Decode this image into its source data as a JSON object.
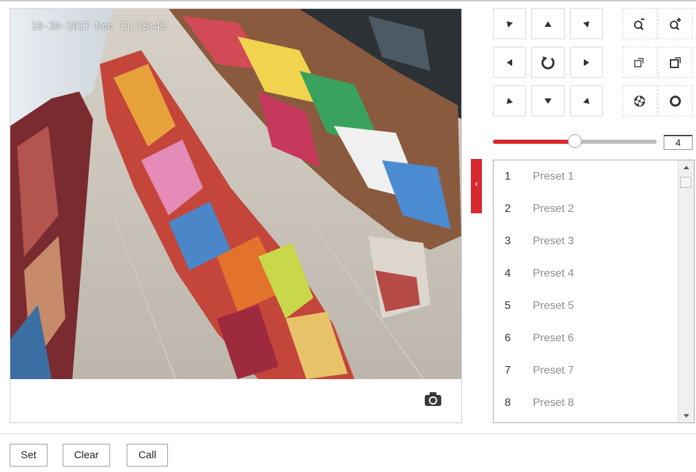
{
  "video": {
    "timestamp": "10-30-2017 Mon 11:18:43"
  },
  "ptz": {
    "direction_icons": [
      "arrow-up-left-icon",
      "arrow-up-icon",
      "arrow-up-right-icon",
      "arrow-left-icon",
      "auto-scan-icon",
      "arrow-right-icon",
      "arrow-down-left-icon",
      "arrow-down-icon",
      "arrow-down-right-icon"
    ],
    "tool_icons": [
      "zoom-out-icon",
      "zoom-in-icon",
      "focus-near-icon",
      "focus-far-icon",
      "iris-close-icon",
      "iris-open-icon"
    ]
  },
  "speed": {
    "value": "4",
    "level_fraction": 0.5
  },
  "presets": [
    {
      "number": "1",
      "name": "Preset 1"
    },
    {
      "number": "2",
      "name": "Preset 2"
    },
    {
      "number": "3",
      "name": "Preset 3"
    },
    {
      "number": "4",
      "name": "Preset 4"
    },
    {
      "number": "5",
      "name": "Preset 5"
    },
    {
      "number": "6",
      "name": "Preset 6"
    },
    {
      "number": "7",
      "name": "Preset 7"
    },
    {
      "number": "8",
      "name": "Preset 8"
    }
  ],
  "actions": {
    "set_label": "Set",
    "clear_label": "Clear",
    "call_label": "Call"
  },
  "colors": {
    "accent": "#d8292f",
    "track": "#bcbcbc",
    "preset_name": "#8c8c8c"
  },
  "icons": {
    "snapshot": "camera-icon",
    "collapse": "chevron-left-icon"
  }
}
